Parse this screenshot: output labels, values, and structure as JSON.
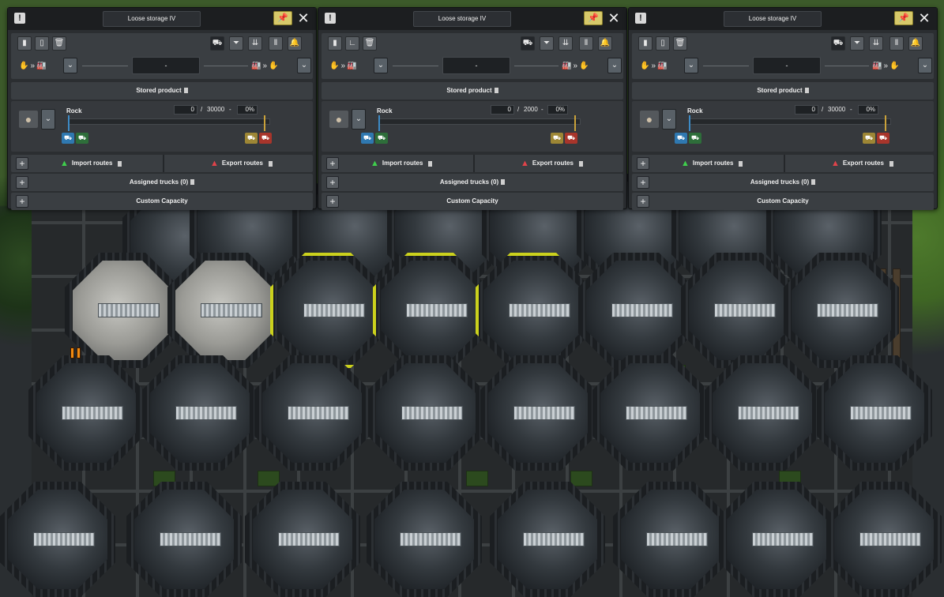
{
  "colors": {
    "highlight": "#cbd11d",
    "pin": "#d7c96a",
    "import": "#3fcf4c",
    "export": "#e0434a",
    "pause": "#f08a12"
  },
  "panels": [
    {
      "title": "Loose storage IV",
      "route_value": "-",
      "stored_product_label": "Stored product",
      "product_name": "Rock",
      "quantity": "0",
      "capacity": "30000",
      "qty_dash": "-",
      "percent": "0%",
      "fill_fraction": 0.0,
      "import_label": "Import routes",
      "export_label": "Export routes",
      "assigned_trucks_label": "Assigned trucks (0)",
      "custom_capacity_label": "Custom Capacity"
    },
    {
      "title": "Loose storage IV",
      "route_value": "-",
      "stored_product_label": "Stored product",
      "product_name": "Rock",
      "quantity": "0",
      "capacity": "2000",
      "qty_dash": "-",
      "percent": "0%",
      "fill_fraction": 0.0,
      "import_label": "Import routes",
      "export_label": "Export routes",
      "assigned_trucks_label": "Assigned trucks (0)",
      "custom_capacity_label": "Custom Capacity"
    },
    {
      "title": "Loose storage IV",
      "route_value": "-",
      "stored_product_label": "Stored product",
      "product_name": "Rock",
      "quantity": "0",
      "capacity": "30000",
      "qty_dash": "-",
      "percent": "0%",
      "fill_fraction": 0.0,
      "import_label": "Import routes",
      "export_label": "Export routes",
      "assigned_trucks_label": "Assigned trucks (0)",
      "custom_capacity_label": "Custom Capacity"
    }
  ],
  "icons": {
    "info": "info-icon",
    "pin": "pin-icon",
    "close": "close-icon",
    "rock": "rock-icon",
    "plus": "plus-icon",
    "import": "import-triangle-icon",
    "export": "export-triangle-icon"
  },
  "glyphs": {
    "info": "!",
    "pin": "📌",
    "close": "✕",
    "dropdown": "⌄",
    "plus": "+",
    "slash": "/",
    "arrows": "»",
    "triangle": "▲"
  }
}
